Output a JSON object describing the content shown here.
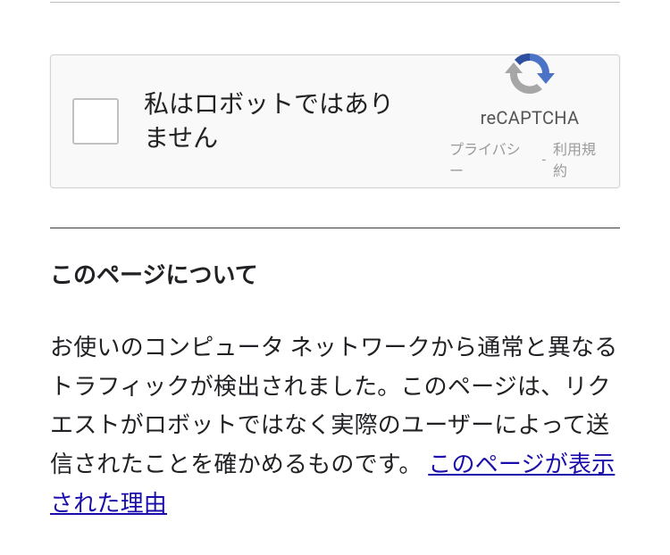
{
  "recaptcha": {
    "checkbox_label": "私はロボットではありません",
    "brand": "reCAPTCHA",
    "privacy_label": "プライバシー",
    "separator": "-",
    "terms_label": "利用規約"
  },
  "section": {
    "heading": "このページについて",
    "body_prefix": "お使いのコンピュータ ネットワークから通常と異なるトラフィックが検出されました。このページは、リクエストがロボットではなく実際のユーザーによって送信されたことを確かめるものです。",
    "reason_link_label": "このページが表示された理由"
  },
  "colors": {
    "link": "#1a0dab",
    "muted": "#9a9a9a"
  }
}
